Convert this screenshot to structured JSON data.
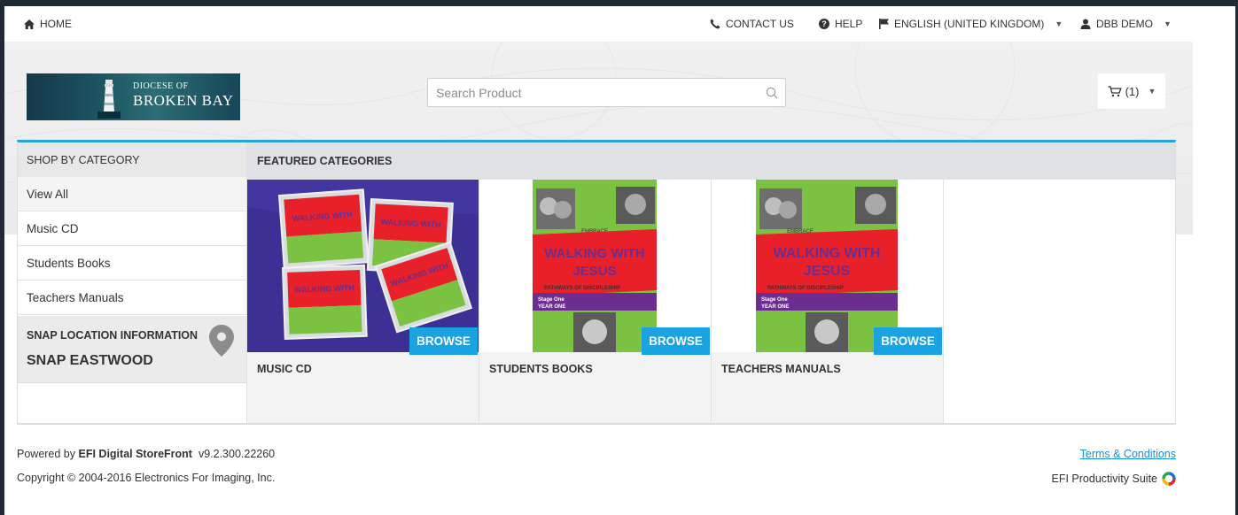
{
  "topnav": {
    "home": "HOME",
    "contact": "CONTACT US",
    "help": "HELP",
    "language": "ENGLISH (UNITED KINGDOM)",
    "user": "DBB DEMO"
  },
  "header": {
    "logo_line1": "DIOCESE OF",
    "logo_line2": "BROKEN BAY",
    "search_placeholder": "Search Product",
    "cart_label": "(1)"
  },
  "sidebar": {
    "title": "SHOP BY CATEGORY",
    "items": [
      {
        "label": "View All"
      },
      {
        "label": "Music CD"
      },
      {
        "label": "Students Books"
      },
      {
        "label": "Teachers Manuals"
      }
    ],
    "snap_label": "SNAP LOCATION INFORMATION",
    "snap_value": "SNAP EASTWOOD"
  },
  "featured": {
    "title": "FEATURED CATEGORIES",
    "tiles": [
      {
        "label": "MUSIC CD",
        "button": "BROWSE"
      },
      {
        "label": "STUDENTS BOOKS",
        "button": "BROWSE"
      },
      {
        "label": "TEACHERS MANUALS",
        "button": "BROWSE"
      }
    ],
    "book_title_1": "WALKING WITH",
    "book_title_2": "JESUS",
    "book_sub": "PATHWAYS OF DISCIPLESHIP",
    "book_stage": "Stage One",
    "book_year": "YEAR ONE",
    "book_word": "EMBRACE"
  },
  "footer": {
    "powered_prefix": "Powered by",
    "powered_brand": "EFI Digital StoreFront",
    "version": "v9.2.300.22260",
    "copyright": "Copyright © 2004-2016 Electronics For Imaging, Inc.",
    "terms": "Terms & Conditions",
    "suite": "EFI Productivity Suite"
  },
  "colors": {
    "accent": "#29a3dd",
    "browse": "#1aa3e0",
    "link": "#1a8fd8",
    "book_red": "#e8202a",
    "book_green": "#7cc242",
    "book_purple": "#6b2d8f",
    "cd_bg": "#3a2f8a"
  }
}
